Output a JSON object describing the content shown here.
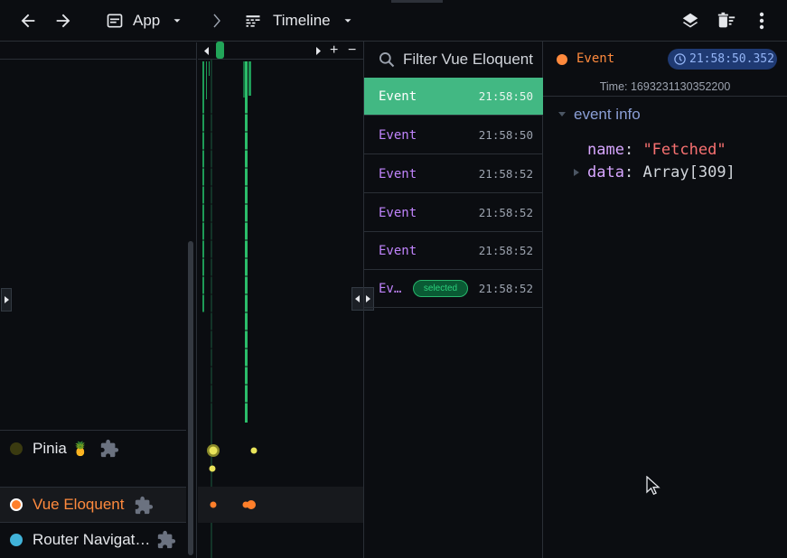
{
  "toolbar": {
    "app_label": "App",
    "timeline_label": "Timeline"
  },
  "layers": [
    {
      "name": "Pinia",
      "emoji": "🍍",
      "color": "#3a3a10"
    },
    {
      "name": "Vue Eloquent",
      "color": "#ff7f2a"
    },
    {
      "name": "Router Navigat…",
      "color": "#41b3d9"
    }
  ],
  "events": {
    "filter_placeholder": "Filter Vue Eloquent",
    "selected_badge": "selected",
    "rows": [
      {
        "title": "Event",
        "time": "21:58:50"
      },
      {
        "title": "Event",
        "time": "21:58:50"
      },
      {
        "title": "Event",
        "time": "21:58:52"
      },
      {
        "title": "Event",
        "time": "21:58:52"
      },
      {
        "title": "Event",
        "time": "21:58:52"
      },
      {
        "title": "Ev…",
        "time": "21:58:52"
      }
    ]
  },
  "detail": {
    "title": "Event",
    "time_badge": "21:58:50.352",
    "time_line": "Time: 1693231130352200",
    "section": "event info",
    "props": [
      {
        "key": "name",
        "value": "\"Fetched\""
      },
      {
        "key": "data",
        "value": "Array[309]"
      }
    ]
  },
  "colors": {
    "accent": "#42b883",
    "event_title": "#c084fc",
    "vue_eloquent": "#ff7f2a",
    "router": "#41b3d9"
  }
}
